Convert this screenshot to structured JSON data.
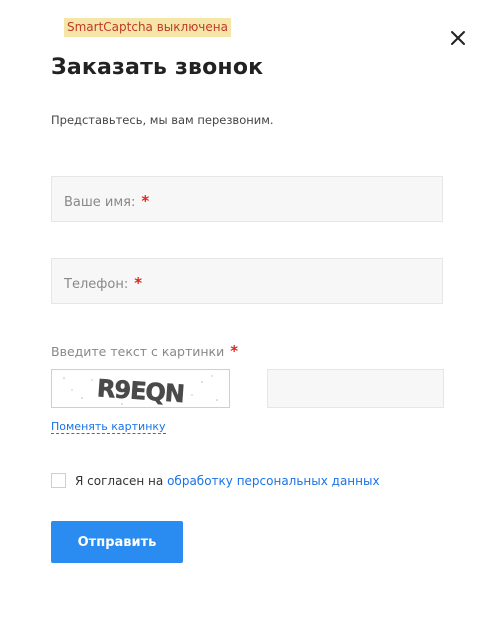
{
  "captcha_notice": "SmartCaptcha выключена",
  "modal": {
    "title": "Заказать звонок",
    "subtitle": "Представьтесь, мы вам перезвоним."
  },
  "form": {
    "name_label": "Ваше имя:",
    "phone_label": "Телефон:",
    "required_mark": "*",
    "captcha_label": "Введите текст с картинки",
    "captcha_text": "R9EQN",
    "change_image_link": "Поменять картинку",
    "agree_prefix": "Я согласен на ",
    "agree_link": "обработку персональных данных",
    "submit_label": "Отправить"
  },
  "colors": {
    "accent": "#2a8cf0",
    "link": "#1a73e8",
    "required": "#e0261b"
  },
  "icons": {
    "close": "close-icon"
  }
}
